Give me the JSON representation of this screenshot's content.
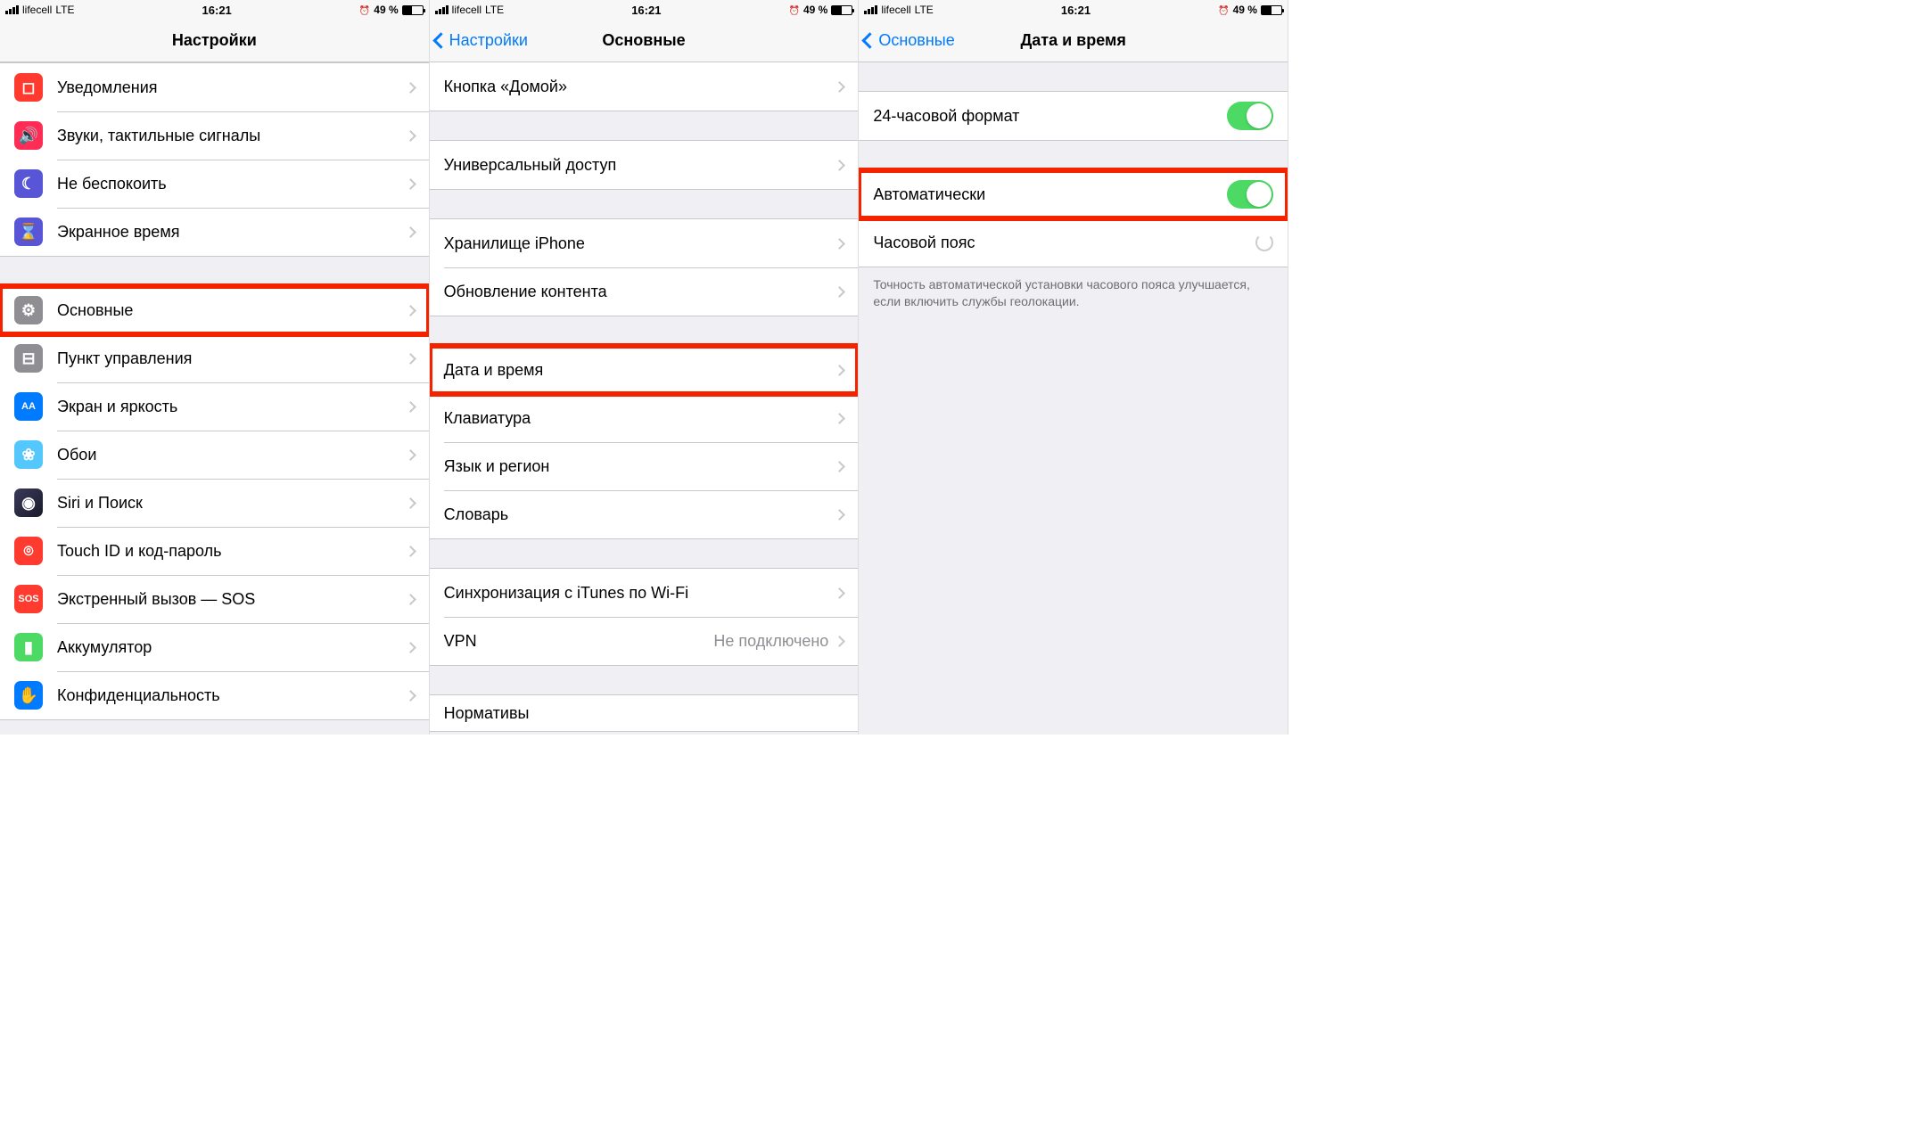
{
  "status": {
    "carrier": "lifecell",
    "network": "LTE",
    "time": "16:21",
    "battery_pct": "49 %"
  },
  "screen1": {
    "title": "Настройки",
    "rows_g1": [
      {
        "label": "Уведомления",
        "icon": "ic-red",
        "glyph": "◻"
      },
      {
        "label": "Звуки, тактильные сигналы",
        "icon": "ic-pink",
        "glyph": "🔊"
      },
      {
        "label": "Не беспокоить",
        "icon": "ic-purple",
        "glyph": "☾"
      },
      {
        "label": "Экранное время",
        "icon": "ic-indigo",
        "glyph": "⌛"
      }
    ],
    "rows_g2": [
      {
        "label": "Основные",
        "icon": "ic-grey",
        "glyph": "⚙",
        "hl": true
      },
      {
        "label": "Пункт управления",
        "icon": "ic-grey",
        "glyph": "⊟"
      },
      {
        "label": "Экран и яркость",
        "icon": "ic-blue",
        "glyph": "AA"
      },
      {
        "label": "Обои",
        "icon": "ic-cyan",
        "glyph": "❀"
      },
      {
        "label": "Siri и Поиск",
        "icon": "ic-siri",
        "glyph": "◉"
      },
      {
        "label": "Touch ID и код-пароль",
        "icon": "ic-red",
        "glyph": "⌾"
      },
      {
        "label": "Экстренный вызов — SOS",
        "icon": "ic-red",
        "glyph": "SOS"
      },
      {
        "label": "Аккумулятор",
        "icon": "ic-green",
        "glyph": "▮"
      },
      {
        "label": "Конфиденциальность",
        "icon": "ic-blue",
        "glyph": "✋"
      }
    ]
  },
  "screen2": {
    "back": "Настройки",
    "title": "Основные",
    "g1": [
      {
        "label": "Кнопка «Домой»"
      }
    ],
    "g2": [
      {
        "label": "Универсальный доступ"
      }
    ],
    "g3": [
      {
        "label": "Хранилище iPhone"
      },
      {
        "label": "Обновление контента"
      }
    ],
    "g4": [
      {
        "label": "Дата и время",
        "hl": true
      },
      {
        "label": "Клавиатура"
      },
      {
        "label": "Язык и регион"
      },
      {
        "label": "Словарь"
      }
    ],
    "g5": [
      {
        "label": "Синхронизация с iTunes по Wi-Fi"
      },
      {
        "label": "VPN",
        "value": "Не подключено"
      }
    ],
    "g6": [
      {
        "label": "Нормативы"
      }
    ]
  },
  "screen3": {
    "back": "Основные",
    "title": "Дата и время",
    "r1_label": "24-часовой формат",
    "r2_label": "Автоматически",
    "r3_label": "Часовой пояс",
    "footer": "Точность автоматической установки часового пояса улучшается, если включить службы геолокации."
  }
}
